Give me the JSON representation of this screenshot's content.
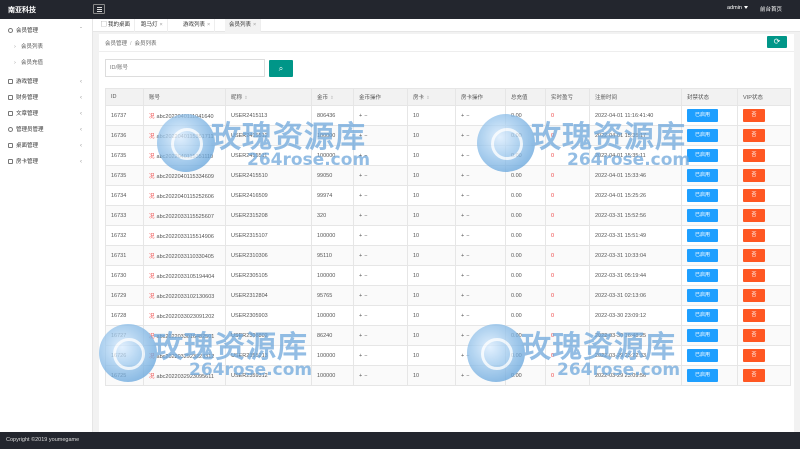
{
  "app": {
    "title": "南亚科技",
    "user": "admin",
    "home_link": "前台首页"
  },
  "sidebar": {
    "items": [
      {
        "label": "会员管理",
        "expanded": true
      },
      {
        "label": "会员列表",
        "sub": true
      },
      {
        "label": "会员充值",
        "sub": true
      },
      {
        "label": "游戏管理"
      },
      {
        "label": "财务管理"
      },
      {
        "label": "文章管理"
      },
      {
        "label": "管理员管理"
      },
      {
        "label": "桌面管理"
      },
      {
        "label": "房卡管理"
      }
    ]
  },
  "tabs": [
    {
      "label": "我的桌面"
    },
    {
      "label": "跑马灯",
      "closable": true
    },
    {
      "label": "游戏列表",
      "closable": true
    },
    {
      "label": "会员列表",
      "closable": true,
      "active": true
    }
  ],
  "breadcrumb": {
    "parent": "会员管理",
    "current": "会员列表"
  },
  "search": {
    "placeholder": "ID/账号"
  },
  "table": {
    "headers": [
      "ID",
      "账号",
      "昵称",
      "金币",
      "金币操作",
      "房卡",
      "房卡操作",
      "总充值",
      "实时盈亏",
      "注册时间",
      "封禁状态",
      "VIP状态"
    ],
    "rows": [
      {
        "id": "16737",
        "account": "abc2022040111041640",
        "nick": "USER2415113",
        "gold": "806436",
        "card": "10",
        "recharge": "0.00",
        "profit": "0",
        "time": "2022-04-01 11:16:41:40",
        "ban": "已启用",
        "vip": "否"
      },
      {
        "id": "16736",
        "account": "abc2022040115351711",
        "nick": "USER2415512",
        "gold": "100000",
        "card": "10",
        "recharge": "0.00",
        "profit": "0",
        "time": "2022-04-01 15:35:17",
        "ban": "已启用",
        "vip": "否"
      },
      {
        "id": "16735",
        "account": "abc2022040115351110",
        "nick": "USER2415511",
        "gold": "100000",
        "card": "10",
        "recharge": "0.00",
        "profit": "0",
        "time": "2022-04-01 15:35:11",
        "ban": "已启用",
        "vip": "否"
      },
      {
        "id": "16735",
        "account": "abc2022040115334609",
        "nick": "USER2415510",
        "gold": "99050",
        "card": "10",
        "recharge": "0.00",
        "profit": "0",
        "time": "2022-04-01 15:33:46",
        "ban": "已启用",
        "vip": "否"
      },
      {
        "id": "16734",
        "account": "abc2022040115252606",
        "nick": "USER2416509",
        "gold": "99974",
        "card": "10",
        "recharge": "0.00",
        "profit": "0",
        "time": "2022-04-01 15:25:26",
        "ban": "已启用",
        "vip": "否"
      },
      {
        "id": "16733",
        "account": "abc2022033115525607",
        "nick": "USER2315208",
        "gold": "320",
        "card": "10",
        "recharge": "0.00",
        "profit": "0",
        "time": "2022-03-31 15:52:56",
        "ban": "已启用",
        "vip": "否"
      },
      {
        "id": "16732",
        "account": "abc2022033115514906",
        "nick": "USER2315107",
        "gold": "100000",
        "card": "10",
        "recharge": "0.00",
        "profit": "0",
        "time": "2022-03-31 15:51:49",
        "ban": "已启用",
        "vip": "否"
      },
      {
        "id": "16731",
        "account": "abc2022033110330405",
        "nick": "USER2310306",
        "gold": "95110",
        "card": "10",
        "recharge": "0.00",
        "profit": "0",
        "time": "2022-03-31 10:33:04",
        "ban": "已启用",
        "vip": "否"
      },
      {
        "id": "16730",
        "account": "abc2022033105194404",
        "nick": "USER2305105",
        "gold": "100000",
        "card": "10",
        "recharge": "0.00",
        "profit": "0",
        "time": "2022-03-31 05:19:44",
        "ban": "已启用",
        "vip": "否"
      },
      {
        "id": "16729",
        "account": "abc2022033102130603",
        "nick": "USER2312804",
        "gold": "95765",
        "card": "10",
        "recharge": "0.00",
        "profit": "0",
        "time": "2022-03-31 02:13:06",
        "ban": "已启用",
        "vip": "否"
      },
      {
        "id": "16728",
        "account": "abc2022033023091202",
        "nick": "USER2305903",
        "gold": "100000",
        "card": "10",
        "recharge": "0.00",
        "profit": "0",
        "time": "2022-03-30 23:09:12",
        "ban": "已启用",
        "vip": "否"
      },
      {
        "id": "16727",
        "account": "abc2022033016482501",
        "nick": "USER2308802",
        "gold": "86240",
        "card": "10",
        "recharge": "0.00",
        "profit": "0",
        "time": "2022-03-30 16:48:25",
        "ban": "已启用",
        "vip": "否"
      },
      {
        "id": "16726",
        "account": "abc2022032923223312",
        "nick": "USER2355213",
        "gold": "100000",
        "card": "10",
        "recharge": "0.00",
        "profit": "0",
        "time": "2022-03-29 23:22:33",
        "ban": "已启用",
        "vip": "否"
      },
      {
        "id": "16725",
        "account": "abc2022032923095611",
        "nick": "USER2359312",
        "gold": "100000",
        "card": "10",
        "recharge": "0.00",
        "profit": "0",
        "time": "2022-03-29 23:09:56",
        "ban": "已启用",
        "vip": "否"
      }
    ]
  },
  "watermark": {
    "cn": "玫瑰资源库",
    "en": "264rose.com"
  },
  "footer": {
    "text": "Copyright ©2019 youmegame"
  },
  "colors": {
    "topbar": "#23262e",
    "primary": "#009688",
    "blue": "#1e9fff",
    "orange": "#ff5722"
  }
}
